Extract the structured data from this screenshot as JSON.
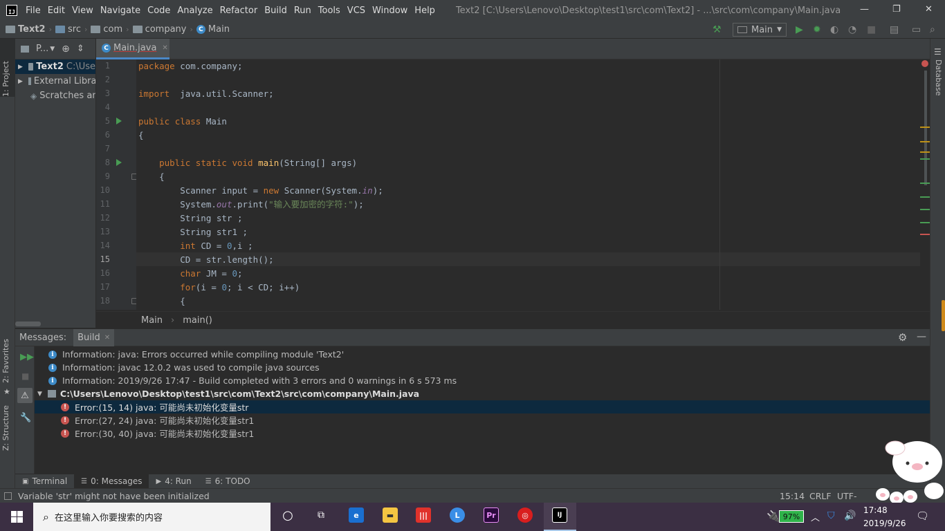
{
  "window": {
    "menu": [
      "File",
      "Edit",
      "View",
      "Navigate",
      "Code",
      "Analyze",
      "Refactor",
      "Build",
      "Run",
      "Tools",
      "VCS",
      "Window",
      "Help"
    ],
    "title": "Text2 [C:\\Users\\Lenovo\\Desktop\\test1\\src\\com\\Text2] - ...\\src\\com\\company\\Main.java",
    "controls": {
      "minimize": "—",
      "restore": "❐",
      "close": "✕"
    }
  },
  "navbar": {
    "crumbs": [
      "Text2",
      "src",
      "com",
      "company",
      "Main"
    ],
    "run_config": "Main"
  },
  "left_stripe": {
    "project_tab": "1: Project",
    "favorites_tab": "2: Favorites",
    "structure_tab": "Z: Structure"
  },
  "right_stripe": {
    "database_tab": "Database"
  },
  "project_panel": {
    "header_label": "P...",
    "tree": [
      {
        "name": "Text2",
        "path": "C:\\Use"
      },
      {
        "name": "External Libra"
      },
      {
        "name": "Scratches and"
      }
    ]
  },
  "editor": {
    "tab_label": "Main.java",
    "line_numbers": [
      "1",
      "2",
      "3",
      "4",
      "5",
      "6",
      "7",
      "8",
      "9",
      "10",
      "11",
      "12",
      "13",
      "14",
      "15",
      "16",
      "17",
      "18"
    ],
    "lines": [
      "package com.company;",
      "",
      "import  java.util.Scanner;",
      "",
      "public class Main",
      "{",
      "",
      "    public static void main(String[] args)",
      "    {",
      "        Scanner input = new Scanner(System.in);",
      "        System.out.print(\"输入要加密的字符:\");",
      "        String str ;",
      "        String str1 ;",
      "        int CD = 0,i ;",
      "        CD = str.length();",
      "        char JM = 0;",
      "        for(i = 0; i < CD; i++)",
      "        {"
    ],
    "breadcrumb": [
      "Main",
      "main()"
    ]
  },
  "messages": {
    "header_label": "Messages:",
    "active_tab": "Build",
    "rows": [
      {
        "type": "info",
        "text": "Information: java: Errors occurred while compiling module 'Text2'"
      },
      {
        "type": "info",
        "text": "Information: javac 12.0.2 was used to compile java sources"
      },
      {
        "type": "info",
        "text": "Information: 2019/9/26 17:47 - Build completed with 3 errors and 0 warnings in 6 s 573 ms"
      },
      {
        "type": "file",
        "text": "C:\\Users\\Lenovo\\Desktop\\test1\\src\\com\\Text2\\src\\com\\company\\Main.java"
      },
      {
        "type": "error",
        "text": "Error:(15, 14)  java: 可能尚未初始化变量str"
      },
      {
        "type": "error",
        "text": "Error:(27, 24)  java: 可能尚未初始化变量str1"
      },
      {
        "type": "error",
        "text": "Error:(30, 40)  java: 可能尚未初始化变量str1"
      }
    ]
  },
  "bottom_tabs": [
    {
      "label": "Terminal"
    },
    {
      "label": "0: Messages"
    },
    {
      "label": "4: Run"
    },
    {
      "label": "6: TODO"
    }
  ],
  "statusbar": {
    "message": "Variable 'str' might not have been initialized",
    "position": "15:14",
    "line_sep": "CRLF",
    "encoding": "UTF-"
  },
  "taskbar": {
    "search_placeholder": "在这里输入你要搜索的内容",
    "battery": "97%",
    "time": "17:48",
    "date": "2019/9/26"
  },
  "colors": {
    "keyword": "#cc7832",
    "string": "#6a8759",
    "number": "#6897bb",
    "method": "#ffc66d",
    "static_field": "#9876aa",
    "unused": "#808080"
  }
}
